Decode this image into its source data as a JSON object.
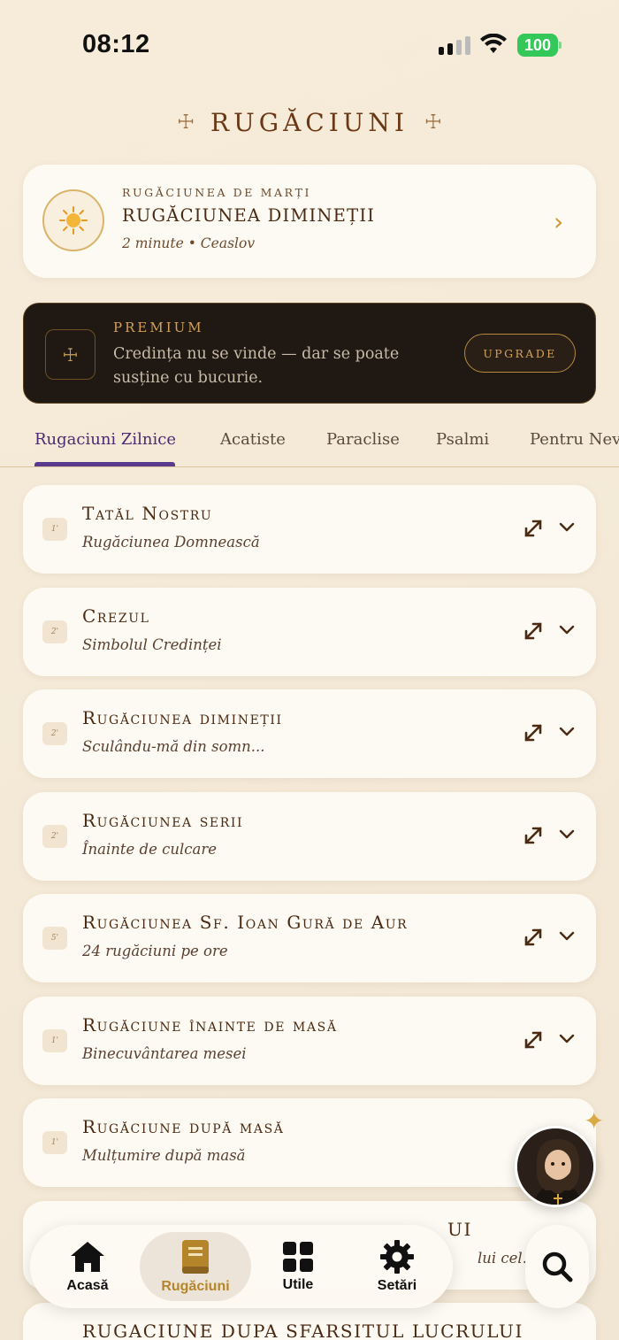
{
  "status_bar": {
    "time": "08:12",
    "battery": "100"
  },
  "header": {
    "title": "RUGĂCIUNI"
  },
  "featured": {
    "kicker": "RUGĂCIUNEA DE MARȚI",
    "title": "RUGĂCIUNEA DIMINEȚII",
    "meta": "2 minute • Ceaslov",
    "icon": "sun-icon"
  },
  "premium": {
    "label": "PREMIUM",
    "text": "Credința nu se vinde — dar se poate susține cu bucurie.",
    "button": "UPGRADE"
  },
  "tabs": [
    {
      "label": "Rugaciuni Zilnice",
      "active": true
    },
    {
      "label": "Acatiste"
    },
    {
      "label": "Paraclise"
    },
    {
      "label": "Psalmi"
    },
    {
      "label": "Pentru Nevo"
    }
  ],
  "prayers": [
    {
      "badge": "1'",
      "title": "Tatăl Nostru",
      "subtitle": "Rugăciunea Domnească"
    },
    {
      "badge": "2'",
      "title": "Crezul",
      "subtitle": "Simbolul Credinței"
    },
    {
      "badge": "2'",
      "title": "Rugăciunea dimineții",
      "subtitle": "Sculându-mă din somn..."
    },
    {
      "badge": "2'",
      "title": "Rugăciunea serii",
      "subtitle": "Înainte de culcare"
    },
    {
      "badge": "5'",
      "title": "Rugăciunea Sf. Ioan Gură de Aur",
      "subtitle": "24 rugăciuni pe ore"
    },
    {
      "badge": "1'",
      "title": "Rugăciune înainte de masă",
      "subtitle": "Binecuvântarea mesei"
    },
    {
      "badge": "1'",
      "title": "Rugăciune după masă",
      "subtitle": "Mulțumire după masă"
    },
    {
      "badge": "",
      "title": "UI",
      "subtitle": "lui cel..."
    },
    {
      "badge": "",
      "title": "RUGACIUNE DUPA SFARSITUL LUCRULUI",
      "subtitle": ""
    }
  ],
  "nav": [
    {
      "label": "Acasă",
      "icon": "home-icon"
    },
    {
      "label": "Rugăciuni",
      "icon": "book-icon",
      "active": true
    },
    {
      "label": "Utile",
      "icon": "grid-icon"
    },
    {
      "label": "Setări",
      "icon": "gear-icon"
    }
  ],
  "colors": {
    "accent_gold": "#c9962f",
    "tab_active": "#5a3a8c",
    "title_brown": "#4a2a12"
  }
}
